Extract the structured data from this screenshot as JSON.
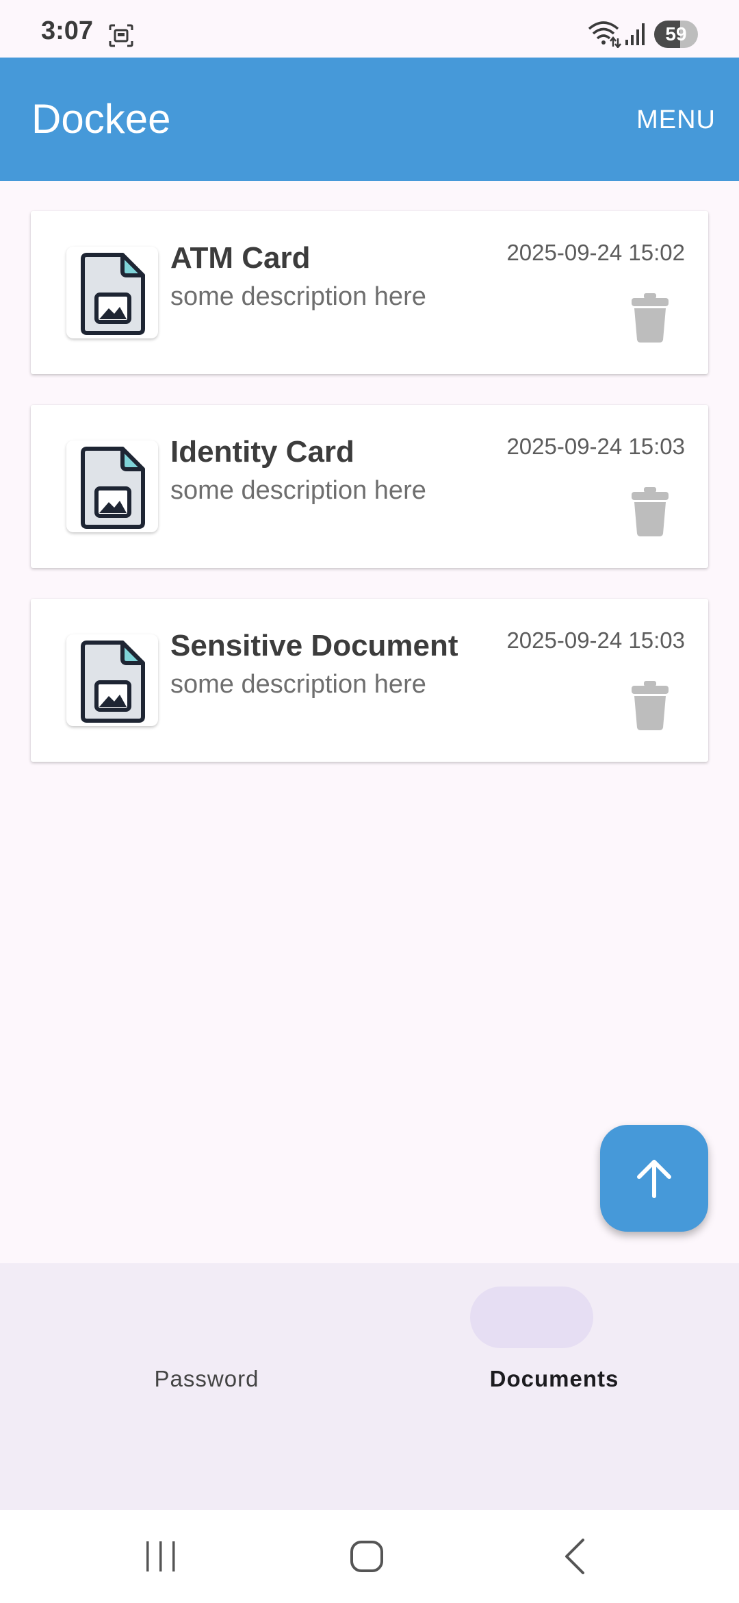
{
  "status_bar": {
    "time": "3:07",
    "battery": "59",
    "battery_level_percent": 59,
    "icons": [
      "screenshot-icon",
      "wifi-icon",
      "signal-icon",
      "battery-icon"
    ]
  },
  "app_bar": {
    "title": "Dockee",
    "menu_label": "MENU",
    "color": "#4699d9"
  },
  "documents": [
    {
      "title": "ATM Card",
      "description": "some description here",
      "date": "2025-09-24 15:02"
    },
    {
      "title": "Identity Card",
      "description": "some description here",
      "date": "2025-09-24 15:03"
    },
    {
      "title": "Sensitive Document",
      "description": "some description here",
      "date": "2025-09-24 15:03"
    }
  ],
  "fab": {
    "icon": "arrow-up-icon"
  },
  "bottom_nav": {
    "items": [
      {
        "label": "Password",
        "active": false
      },
      {
        "label": "Documents",
        "active": true
      }
    ]
  },
  "system_nav": {
    "icons": [
      "recent-apps-icon",
      "home-icon",
      "back-icon"
    ]
  }
}
